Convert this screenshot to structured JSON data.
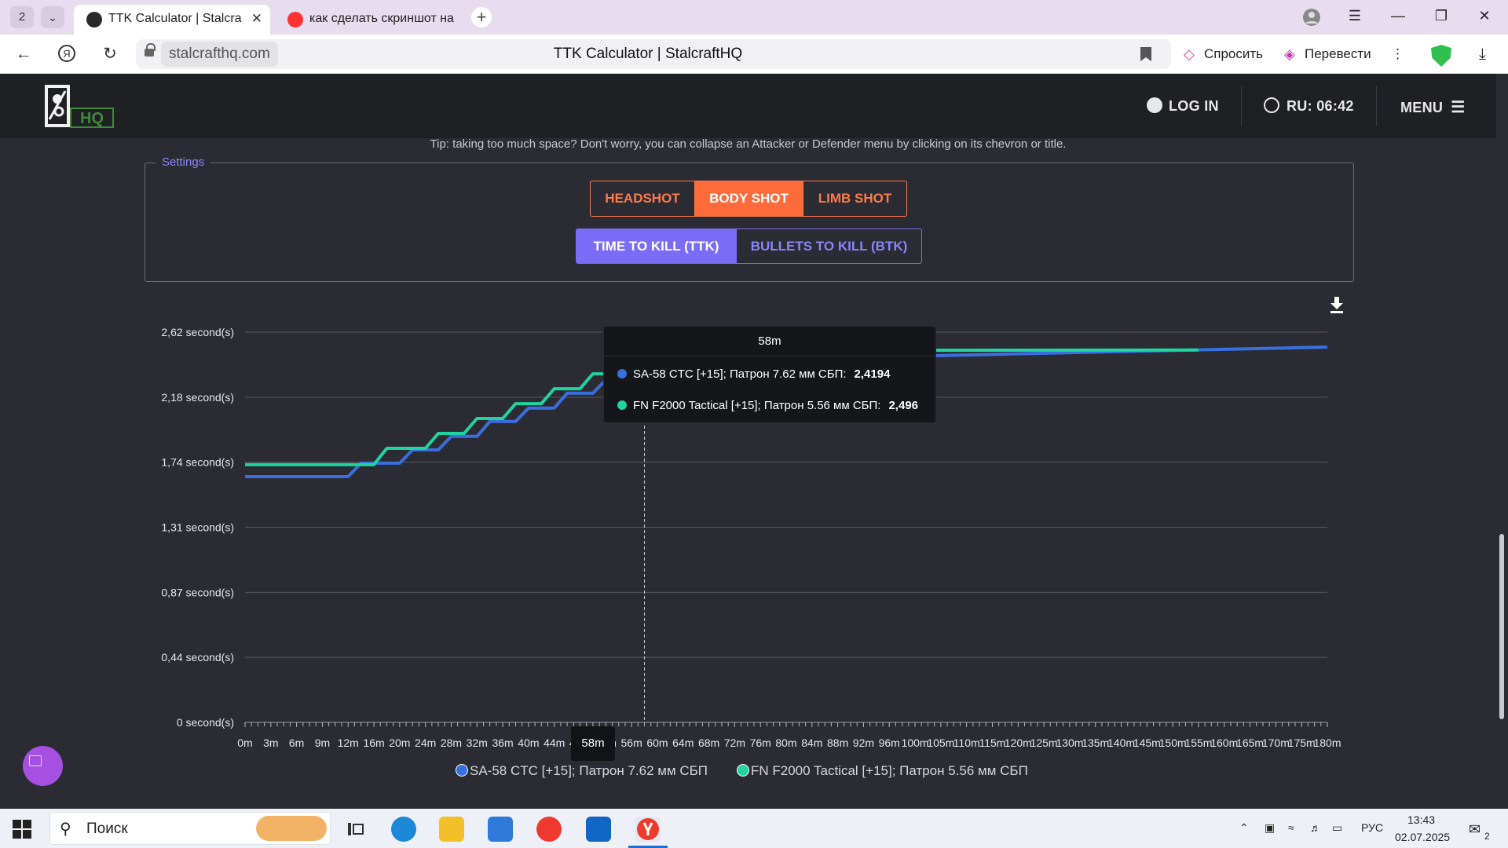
{
  "browser": {
    "tab_count": "2",
    "tabs": [
      {
        "title": "TTK Calculator | Stalcra"
      },
      {
        "title": "как сделать скриншот на"
      }
    ],
    "url_domain": "stalcrafthq.com",
    "page_title": "TTK Calculator | StalcraftHQ",
    "ask_label": "Спросить",
    "translate_label": "Перевести"
  },
  "site_header": {
    "logo_text": "HQ",
    "login_label": "LOG IN",
    "server_time": "RU: 06:42",
    "menu_label": "MENU"
  },
  "tip": "Tip: taking too much space? Don't worry, you can collapse an Attacker or Defender menu by clicking on its chevron or title.",
  "settings": {
    "legend": "Settings",
    "shot_types": [
      "HEADSHOT",
      "BODY SHOT",
      "LIMB SHOT"
    ],
    "selected_shot": "BODY SHOT",
    "modes": [
      "TIME TO KILL (TTK)",
      "BULLETS TO KILL (BTK)"
    ],
    "selected_mode": "TIME TO KILL (TTK)",
    "accent_orange": "#ff6a3a",
    "accent_purple": "#7a6cf5"
  },
  "chart_data": {
    "type": "line",
    "y_ticks": [
      "2,62 second(s)",
      "2,18 second(s)",
      "1,74 second(s)",
      "1,31 second(s)",
      "0,87 second(s)",
      "0,44 second(s)",
      "0 second(s)"
    ],
    "ylim": [
      0,
      2.62
    ],
    "x_ticks": [
      "0m",
      "3m",
      "6m",
      "9m",
      "12m",
      "16m",
      "20m",
      "24m",
      "28m",
      "32m",
      "36m",
      "40m",
      "44m",
      "48m",
      "52m",
      "56m",
      "60m",
      "64m",
      "68m",
      "72m",
      "76m",
      "80m",
      "84m",
      "88m",
      "92m",
      "96m",
      "100m",
      "105m",
      "110m",
      "115m",
      "120m",
      "125m",
      "130m",
      "135m",
      "140m",
      "145m",
      "150m",
      "155m",
      "160m",
      "165m",
      "170m",
      "175m",
      "180m"
    ],
    "series": [
      {
        "name": "SA-58 CTC [+15]; Патрон 7.62 мм СБП",
        "color": "#3a6fe0",
        "points": [
          [
            0,
            1.65
          ],
          [
            12,
            1.65
          ],
          [
            14,
            1.74
          ],
          [
            20,
            1.74
          ],
          [
            22,
            1.83
          ],
          [
            26,
            1.83
          ],
          [
            28,
            1.92
          ],
          [
            32,
            1.92
          ],
          [
            34,
            2.02
          ],
          [
            38,
            2.02
          ],
          [
            40,
            2.11
          ],
          [
            44,
            2.11
          ],
          [
            46,
            2.21
          ],
          [
            50,
            2.21
          ],
          [
            52,
            2.3
          ],
          [
            56,
            2.3
          ],
          [
            58,
            2.4194
          ],
          [
            180,
            2.52
          ]
        ]
      },
      {
        "name": "FN F2000 Tactical [+15]; Патрон 5.56 мм СБП",
        "color": "#20d4a0",
        "points": [
          [
            0,
            1.73
          ],
          [
            16,
            1.73
          ],
          [
            18,
            1.84
          ],
          [
            24,
            1.84
          ],
          [
            26,
            1.94
          ],
          [
            30,
            1.94
          ],
          [
            32,
            2.04
          ],
          [
            36,
            2.04
          ],
          [
            38,
            2.14
          ],
          [
            42,
            2.14
          ],
          [
            44,
            2.24
          ],
          [
            48,
            2.24
          ],
          [
            50,
            2.34
          ],
          [
            54,
            2.34
          ],
          [
            56,
            2.44
          ],
          [
            58,
            2.496
          ],
          [
            155,
            2.5
          ]
        ]
      }
    ],
    "tooltip": {
      "x_label": "58m",
      "rows": [
        {
          "series": "SA-58 CTC [+15]; Патрон 7.62 мм СБП:",
          "value": "2,4194"
        },
        {
          "series": "FN F2000 Tactical [+15]; Патрон 5.56 мм СБП:",
          "value": "2,496"
        }
      ]
    },
    "crosshair_x": "58m",
    "legend": [
      "SA-58 CTC [+15]; Патрон 7.62 мм СБП",
      "FN F2000 Tactical [+15]; Патрон 5.56 мм СБП"
    ],
    "grid": true
  },
  "taskbar": {
    "search_placeholder": "Поиск",
    "language": "РУС",
    "time": "13:43",
    "date": "02.07.2025",
    "notification_count": "2"
  }
}
